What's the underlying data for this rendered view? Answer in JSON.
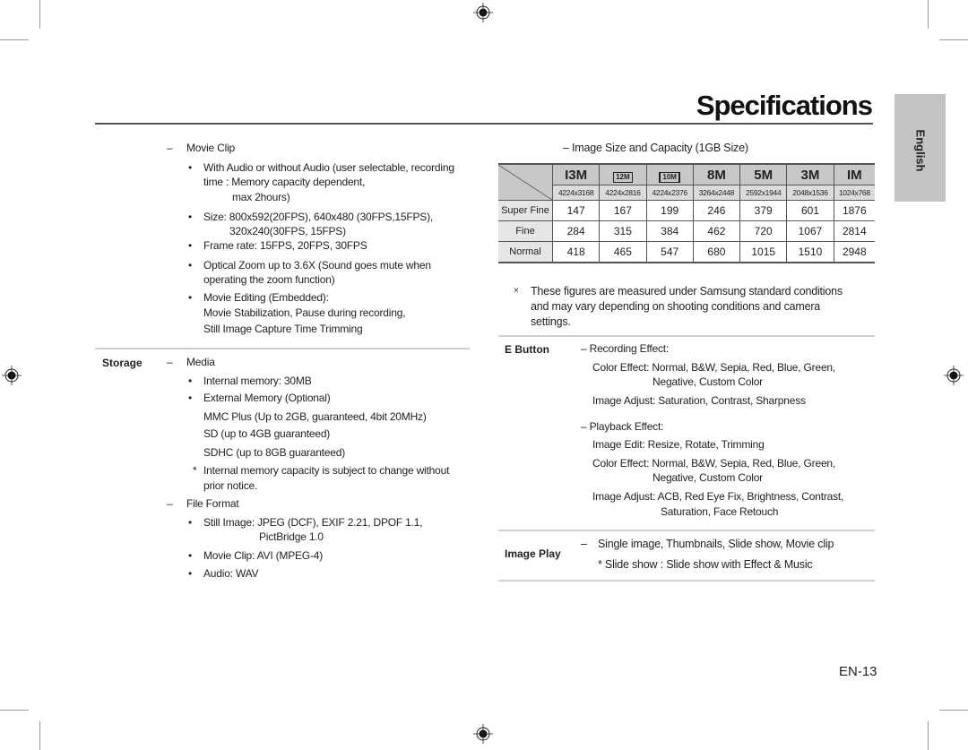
{
  "header": {
    "title": "Specifications",
    "language_tab": "English"
  },
  "left": {
    "movie_clip": {
      "heading": "Movie Clip",
      "bullets": [
        [
          "With Audio or without Audio (user selectable, recording",
          "time : Memory capacity dependent,",
          "max 2hours)"
        ],
        [
          "Size: 800x592(20FPS), 640x480 (30FPS,15FPS),",
          "320x240(30FPS, 15FPS)"
        ],
        [
          "Frame rate: 15FPS, 20FPS, 30FPS"
        ],
        [
          "Optical Zoom up to 3.6X (Sound goes mute when",
          "operating the zoom function)"
        ],
        [
          "Movie Editing (Embedded):",
          "Movie Stabilization, Pause during recording,",
          "Still Image Capture Time Trimming"
        ]
      ]
    },
    "storage": {
      "label": "Storage",
      "media_heading": "Media",
      "media_items": [
        "Internal memory: 30MB",
        "External Memory (Optional)"
      ],
      "external_cards": [
        "MMC Plus (Up to 2GB, guaranteed, 4bit 20MHz)",
        "SD (up to 4GB guaranteed)",
        "SDHC (up to 8GB guaranteed)"
      ],
      "note": [
        "Internal memory capacity is subject to change without",
        "prior notice."
      ],
      "file_format_heading": "File Format",
      "file_formats": [
        [
          "Still Image: JPEG (DCF), EXIF 2.21, DPOF 1.1,",
          "PictBridge 1.0"
        ],
        [
          "Movie Clip: AVI (MPEG-4)"
        ],
        [
          "Audio: WAV"
        ]
      ]
    }
  },
  "right": {
    "table_caption": "– Image Size and Capacity (1GB Size)",
    "table": {
      "size_icons": [
        "13M",
        "12M wide",
        "10M wide",
        "8M",
        "5M",
        "3M",
        "1M"
      ],
      "size_icon_labels": [
        "I3M",
        "12M",
        "10M",
        "8M",
        "5M",
        "3M",
        "IM"
      ],
      "resolutions": [
        "4224x3168",
        "4224x2816",
        "4224x2376",
        "3264x2448",
        "2592x1944",
        "2048x1536",
        "1024x768"
      ],
      "rows": [
        {
          "quality": "Super Fine",
          "values": [
            "147",
            "167",
            "199",
            "246",
            "379",
            "601",
            "1876"
          ]
        },
        {
          "quality": "Fine",
          "values": [
            "284",
            "315",
            "384",
            "462",
            "720",
            "1067",
            "2814"
          ]
        },
        {
          "quality": "Normal",
          "values": [
            "418",
            "465",
            "547",
            "680",
            "1015",
            "1510",
            "2948"
          ]
        }
      ]
    },
    "table_note": [
      "These figures are measured under Samsung standard conditions",
      "and may vary depending on shooting conditions and camera",
      "settings."
    ],
    "table_note_mark": "×",
    "e_button": {
      "label": "E Button",
      "recording_heading": "– Recording Effect:",
      "recording": [
        [
          "Color Effect: Normal, B&W, Sepia, Red, Blue, Green,",
          "Negative, Custom Color"
        ],
        [
          "Image Adjust: Saturation, Contrast, Sharpness"
        ]
      ],
      "playback_heading": "– Playback Effect:",
      "playback": [
        [
          "Image Edit: Resize, Rotate, Trimming"
        ],
        [
          "Color Effect: Normal, B&W, Sepia, Red, Blue, Green,",
          "Negative, Custom Color"
        ],
        [
          "Image Adjust: ACB, Red Eye Fix, Brightness, Contrast,",
          "Saturation, Face Retouch"
        ]
      ]
    },
    "image_play": {
      "label": "Image Play",
      "line1": "Single image, Thumbnails, Slide show, Movie clip",
      "line2": "* Slide show : Slide show with Effect & Music"
    }
  },
  "footer": {
    "page_number": "EN-13"
  },
  "symbols": {
    "dash": "–",
    "bullet": "•",
    "asterisk": "*"
  }
}
